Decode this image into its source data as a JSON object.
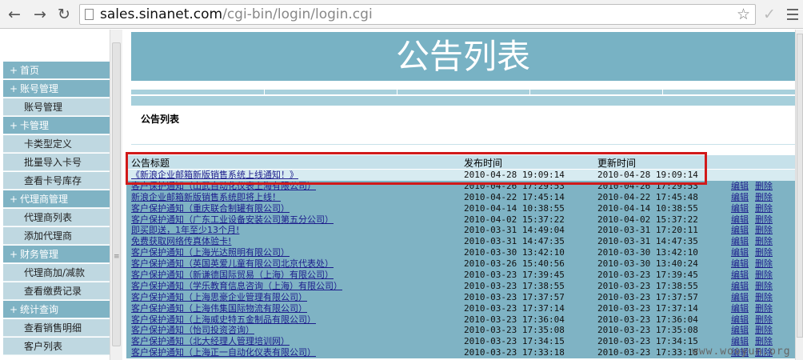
{
  "browser": {
    "url_host": "sales.sinanet.com",
    "url_path": "/cgi-bin/login/login.cgi",
    "back_icon": "←",
    "forward_icon": "→",
    "reload_icon": "↻",
    "star_icon": "☆",
    "check_icon": "✓"
  },
  "sidebar": {
    "sections": [
      {
        "label": "首页",
        "items": []
      },
      {
        "label": "账号管理",
        "items": [
          "账号管理"
        ]
      },
      {
        "label": "卡管理",
        "items": [
          "卡类型定义",
          "批量导入卡号",
          "查看卡号库存"
        ]
      },
      {
        "label": "代理商管理",
        "items": [
          "代理商列表",
          "添加代理商"
        ]
      },
      {
        "label": "财务管理",
        "items": [
          "代理商加/减款",
          "查看缴费记录"
        ]
      },
      {
        "label": "统计查询",
        "items": [
          "查看销售明细",
          "客户列表"
        ]
      }
    ]
  },
  "main": {
    "banner_title": "公告列表",
    "list_heading": "公告列表",
    "columns": {
      "title": "公告标题",
      "published": "发布时间",
      "updated": "更新时间"
    },
    "edit_label": "编辑",
    "delete_label": "删除",
    "rows": [
      {
        "title": "《新浪企业邮箱新版销售系统上线通知！》",
        "published": "2010-04-28 19:09:14",
        "updated": "2010-04-28 19:09:14"
      },
      {
        "title": "客户保护通知（山武自动化仪表上海有限公司）",
        "published": "2010-04-26 17:29:53",
        "updated": "2010-04-26 17:29:53"
      },
      {
        "title": "新浪企业邮箱新版销售系统即将上线！",
        "published": "2010-04-22 17:45:14",
        "updated": "2010-04-22 17:45:48"
      },
      {
        "title": "客户保护通知（重庆联合制罐有限公司）",
        "published": "2010-04-14 10:38:55",
        "updated": "2010-04-14 10:38:55"
      },
      {
        "title": "客户保护通知（广东工业设备安装公司第五分公司）",
        "published": "2010-04-02 15:37:22",
        "updated": "2010-04-02 15:37:22"
      },
      {
        "title": "即买即送，1年至少13个月!",
        "published": "2010-03-31 14:49:04",
        "updated": "2010-03-31 17:20:11"
      },
      {
        "title": "免费获取网络传真体验卡!",
        "published": "2010-03-31 14:47:35",
        "updated": "2010-03-31 14:47:35"
      },
      {
        "title": "客户保护通知（上海光达照明有限公司）",
        "published": "2010-03-30 13:42:10",
        "updated": "2010-03-30 13:42:10"
      },
      {
        "title": "客户保护通知（英国英爱儿童有限公司北京代表处）",
        "published": "2010-03-26 15:40:56",
        "updated": "2010-03-30 13:40:24"
      },
      {
        "title": "客户保护通知（新谦德国际贸易（上海）有限公司）",
        "published": "2010-03-23 17:39:45",
        "updated": "2010-03-23 17:39:45"
      },
      {
        "title": "客户保护通知（学乐教育信息咨询（上海）有限公司）",
        "published": "2010-03-23 17:38:55",
        "updated": "2010-03-23 17:38:55"
      },
      {
        "title": "客户保护通知（上海思豪企业管理有限公司）",
        "published": "2010-03-23 17:37:57",
        "updated": "2010-03-23 17:37:57"
      },
      {
        "title": "客户保护通知（上海伟集国际物流有限公司）",
        "published": "2010-03-23 17:37:14",
        "updated": "2010-03-23 17:37:14"
      },
      {
        "title": "客户保护通知（上海威史特五金制品有限公司）",
        "published": "2010-03-23 17:36:04",
        "updated": "2010-03-23 17:36:04"
      },
      {
        "title": "客户保护通知（怡司投资咨询）",
        "published": "2010-03-23 17:35:08",
        "updated": "2010-03-23 17:35:08"
      },
      {
        "title": "客户保护通知（北大经理人管理培训网）",
        "published": "2010-03-23 17:34:15",
        "updated": "2010-03-23 17:34:15"
      },
      {
        "title": "客户保护通知（上海正一自动化仪表有限公司）",
        "published": "2010-03-23 17:33:18",
        "updated": "2010-03-23 17:33:18"
      }
    ]
  },
  "watermark": "www.wooyun.org",
  "colors": {
    "header_blue": "#78b2c4",
    "highlight": "#d11a1a",
    "link": "#1c1c8c"
  }
}
